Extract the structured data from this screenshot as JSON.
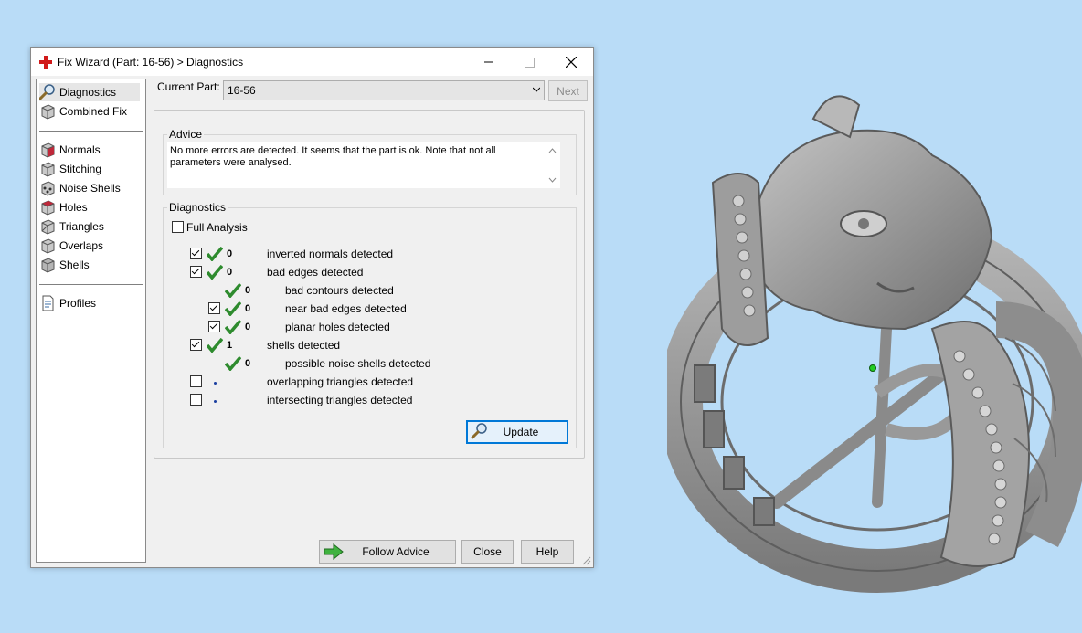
{
  "window": {
    "title": "Fix Wizard (Part: 16-56) > Diagnostics"
  },
  "sidebar": {
    "items": [
      {
        "label": "Diagnostics",
        "icon": "magnifier-icon"
      },
      {
        "label": "Combined Fix",
        "icon": "cube-icon"
      },
      {
        "label": "Normals",
        "icon": "cube-red-face-icon"
      },
      {
        "label": "Stitching",
        "icon": "cube-icon"
      },
      {
        "label": "Noise Shells",
        "icon": "cube-dots-icon"
      },
      {
        "label": "Holes",
        "icon": "cube-red-face-icon"
      },
      {
        "label": "Triangles",
        "icon": "cube-icon"
      },
      {
        "label": "Overlaps",
        "icon": "cube-icon"
      },
      {
        "label": "Shells",
        "icon": "cube-icon"
      },
      {
        "label": "Profiles",
        "icon": "document-icon"
      }
    ]
  },
  "header": {
    "current_part_label": "Current Part:",
    "current_part_value": "16-56",
    "next_label": "Next"
  },
  "advice": {
    "title": "Advice",
    "text": "No more errors are detected. It seems that the part is ok. Note that not all parameters were analysed."
  },
  "diagnostics": {
    "title": "Diagnostics",
    "full_analysis_label": "Full Analysis",
    "rows": [
      {
        "checkbox": true,
        "checked": true,
        "status": "ok",
        "count": "0",
        "label": "inverted normals detected",
        "indent": 0
      },
      {
        "checkbox": true,
        "checked": true,
        "status": "ok",
        "count": "0",
        "label": "bad edges detected",
        "indent": 0
      },
      {
        "checkbox": false,
        "checked": false,
        "status": "ok",
        "count": "0",
        "label": "bad contours detected",
        "indent": 1
      },
      {
        "checkbox": true,
        "checked": true,
        "status": "ok",
        "count": "0",
        "label": "near bad edges detected",
        "indent": 1
      },
      {
        "checkbox": true,
        "checked": true,
        "status": "ok",
        "count": "0",
        "label": "planar holes detected",
        "indent": 1
      },
      {
        "checkbox": true,
        "checked": true,
        "status": "ok",
        "count": "1",
        "label": "shells detected",
        "indent": 0
      },
      {
        "checkbox": false,
        "checked": false,
        "status": "ok",
        "count": "0",
        "label": "possible noise shells detected",
        "indent": 1
      },
      {
        "checkbox": true,
        "checked": false,
        "status": "pending",
        "count": "",
        "label": "overlapping triangles detected",
        "indent": 0
      },
      {
        "checkbox": true,
        "checked": false,
        "status": "pending",
        "count": "",
        "label": "intersecting triangles detected",
        "indent": 0
      }
    ],
    "update_label": "Update"
  },
  "footer": {
    "follow_advice_label": "Follow Advice",
    "close_label": "Close",
    "help_label": "Help"
  },
  "colors": {
    "desktop": "#b9dcf7",
    "check_green": "#2e8b2e",
    "model_grey": "#8f8f8f"
  }
}
